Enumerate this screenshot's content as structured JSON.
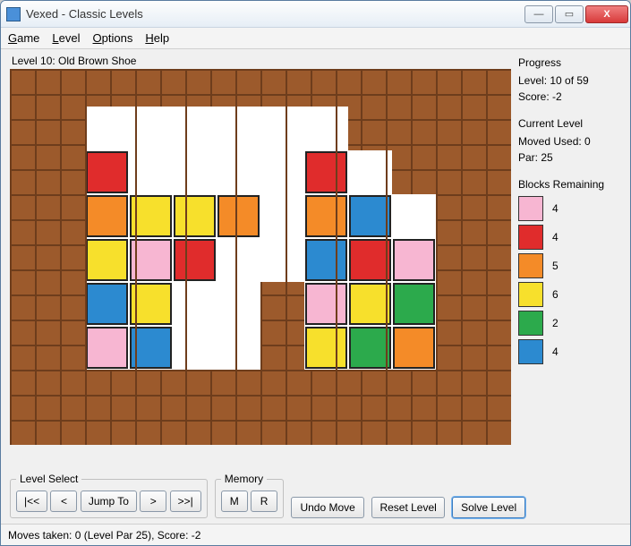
{
  "window": {
    "title": "Vexed - Classic Levels"
  },
  "menubar": {
    "game": "Game",
    "level": "Level",
    "options": "Options",
    "help": "Help"
  },
  "level_caption": "Level 10: Old Brown Shoe",
  "progress": {
    "heading": "Progress",
    "level_line": "Level: 10 of 59",
    "score_line": "Score: -2"
  },
  "current_level": {
    "heading": "Current Level",
    "moved_used_line": "Moved Used: 0",
    "par_line": "Par: 25"
  },
  "blocks_remaining": {
    "heading": "Blocks Remaining",
    "items": [
      {
        "color": "pink",
        "count": "4"
      },
      {
        "color": "red",
        "count": "4"
      },
      {
        "color": "orange",
        "count": "5"
      },
      {
        "color": "yellow",
        "count": "6"
      },
      {
        "color": "green",
        "count": "2"
      },
      {
        "color": "blue",
        "count": "4"
      }
    ]
  },
  "level_select": {
    "legend": "Level Select",
    "first": "|<<",
    "prev": "<",
    "jump": "Jump To",
    "next": ">",
    "last": ">>|"
  },
  "memory": {
    "legend": "Memory",
    "m": "M",
    "r": "R"
  },
  "actions": {
    "undo": "Undo Move",
    "reset": "Reset Level",
    "solve": "Solve Level"
  },
  "statusbar": "Moves taken: 0 (Level Par 25), Score: -2",
  "colors": {
    "pink": "#f7b6d2",
    "red": "#e02c2c",
    "orange": "#f48b28",
    "yellow": "#f7e02c",
    "green": "#2caa4c",
    "blue": "#2c8ad0"
  },
  "board": {
    "cols": 10,
    "rows": 7,
    "cells": [
      [
        "brick",
        "empty",
        "empty",
        "empty",
        "empty",
        "empty",
        "empty",
        "brick",
        "brick",
        "brick"
      ],
      [
        "brick",
        "red",
        "empty",
        "empty",
        "empty",
        "empty",
        "red",
        "empty",
        "brick",
        "brick"
      ],
      [
        "brick",
        "orange",
        "yellow",
        "yellow",
        "orange",
        "empty",
        "orange",
        "blue",
        "empty",
        "brick"
      ],
      [
        "brick",
        "yellow",
        "pink",
        "red",
        "empty",
        "empty",
        "blue",
        "red",
        "pink",
        "brick"
      ],
      [
        "brick",
        "blue",
        "yellow",
        "empty",
        "empty",
        "brick",
        "pink",
        "yellow",
        "green",
        "brick"
      ],
      [
        "brick",
        "pink",
        "blue",
        "empty",
        "empty",
        "brick",
        "yellow",
        "green",
        "orange",
        "brick"
      ],
      [
        "brick",
        "brick",
        "brick",
        "brick",
        "brick",
        "brick",
        "brick",
        "brick",
        "brick",
        "brick"
      ]
    ]
  }
}
